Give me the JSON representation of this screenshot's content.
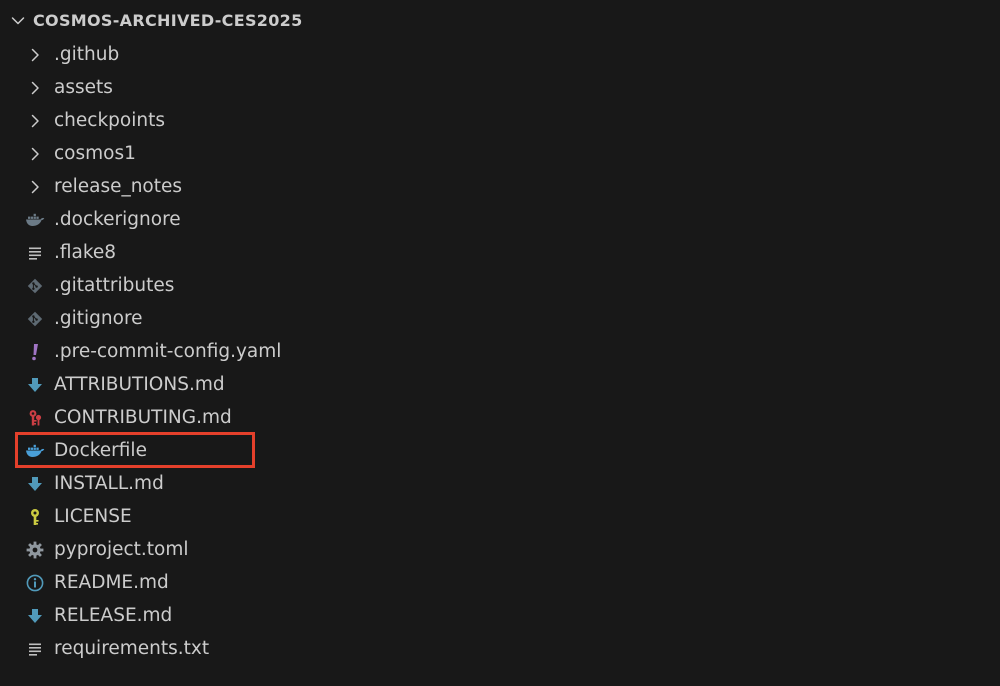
{
  "explorer": {
    "root_label": "COSMOS-ARCHIVED-CES2025",
    "folders": [
      {
        "label": ".github",
        "icon": "chevron-right-icon"
      },
      {
        "label": "assets",
        "icon": "chevron-right-icon"
      },
      {
        "label": "checkpoints",
        "icon": "chevron-right-icon"
      },
      {
        "label": "cosmos1",
        "icon": "chevron-right-icon"
      },
      {
        "label": "release_notes",
        "icon": "chevron-right-icon"
      }
    ],
    "files": [
      {
        "label": ".dockerignore",
        "icon": "docker-icon"
      },
      {
        "label": ".flake8",
        "icon": "lines-icon"
      },
      {
        "label": ".gitattributes",
        "icon": "git-icon"
      },
      {
        "label": ".gitignore",
        "icon": "git-icon"
      },
      {
        "label": ".pre-commit-config.yaml",
        "icon": "yaml-exclamation-icon"
      },
      {
        "label": "ATTRIBUTIONS.md",
        "icon": "markdown-arrow-icon"
      },
      {
        "label": "CONTRIBUTING.md",
        "icon": "contributing-icon"
      },
      {
        "label": "Dockerfile",
        "icon": "docker-icon"
      },
      {
        "label": "INSTALL.md",
        "icon": "markdown-arrow-icon"
      },
      {
        "label": "LICENSE",
        "icon": "license-icon"
      },
      {
        "label": "pyproject.toml",
        "icon": "gear-icon"
      },
      {
        "label": "README.md",
        "icon": "info-icon"
      },
      {
        "label": "RELEASE.md",
        "icon": "markdown-arrow-icon"
      },
      {
        "label": "requirements.txt",
        "icon": "lines-icon"
      }
    ],
    "highlighted_item": "Dockerfile",
    "colors": {
      "background": "#181818",
      "text": "#cccccc",
      "highlight_border": "#e4402b",
      "docker_gray": "#6b7a86",
      "docker_blue": "#4a9fd8",
      "git_gray": "#7f8b94",
      "markdown_blue": "#519aba",
      "yaml_purple": "#a074c4",
      "contributing_red": "#cc3e44",
      "license_yellow": "#cbcb41",
      "gear_gray": "#8f979e"
    }
  }
}
